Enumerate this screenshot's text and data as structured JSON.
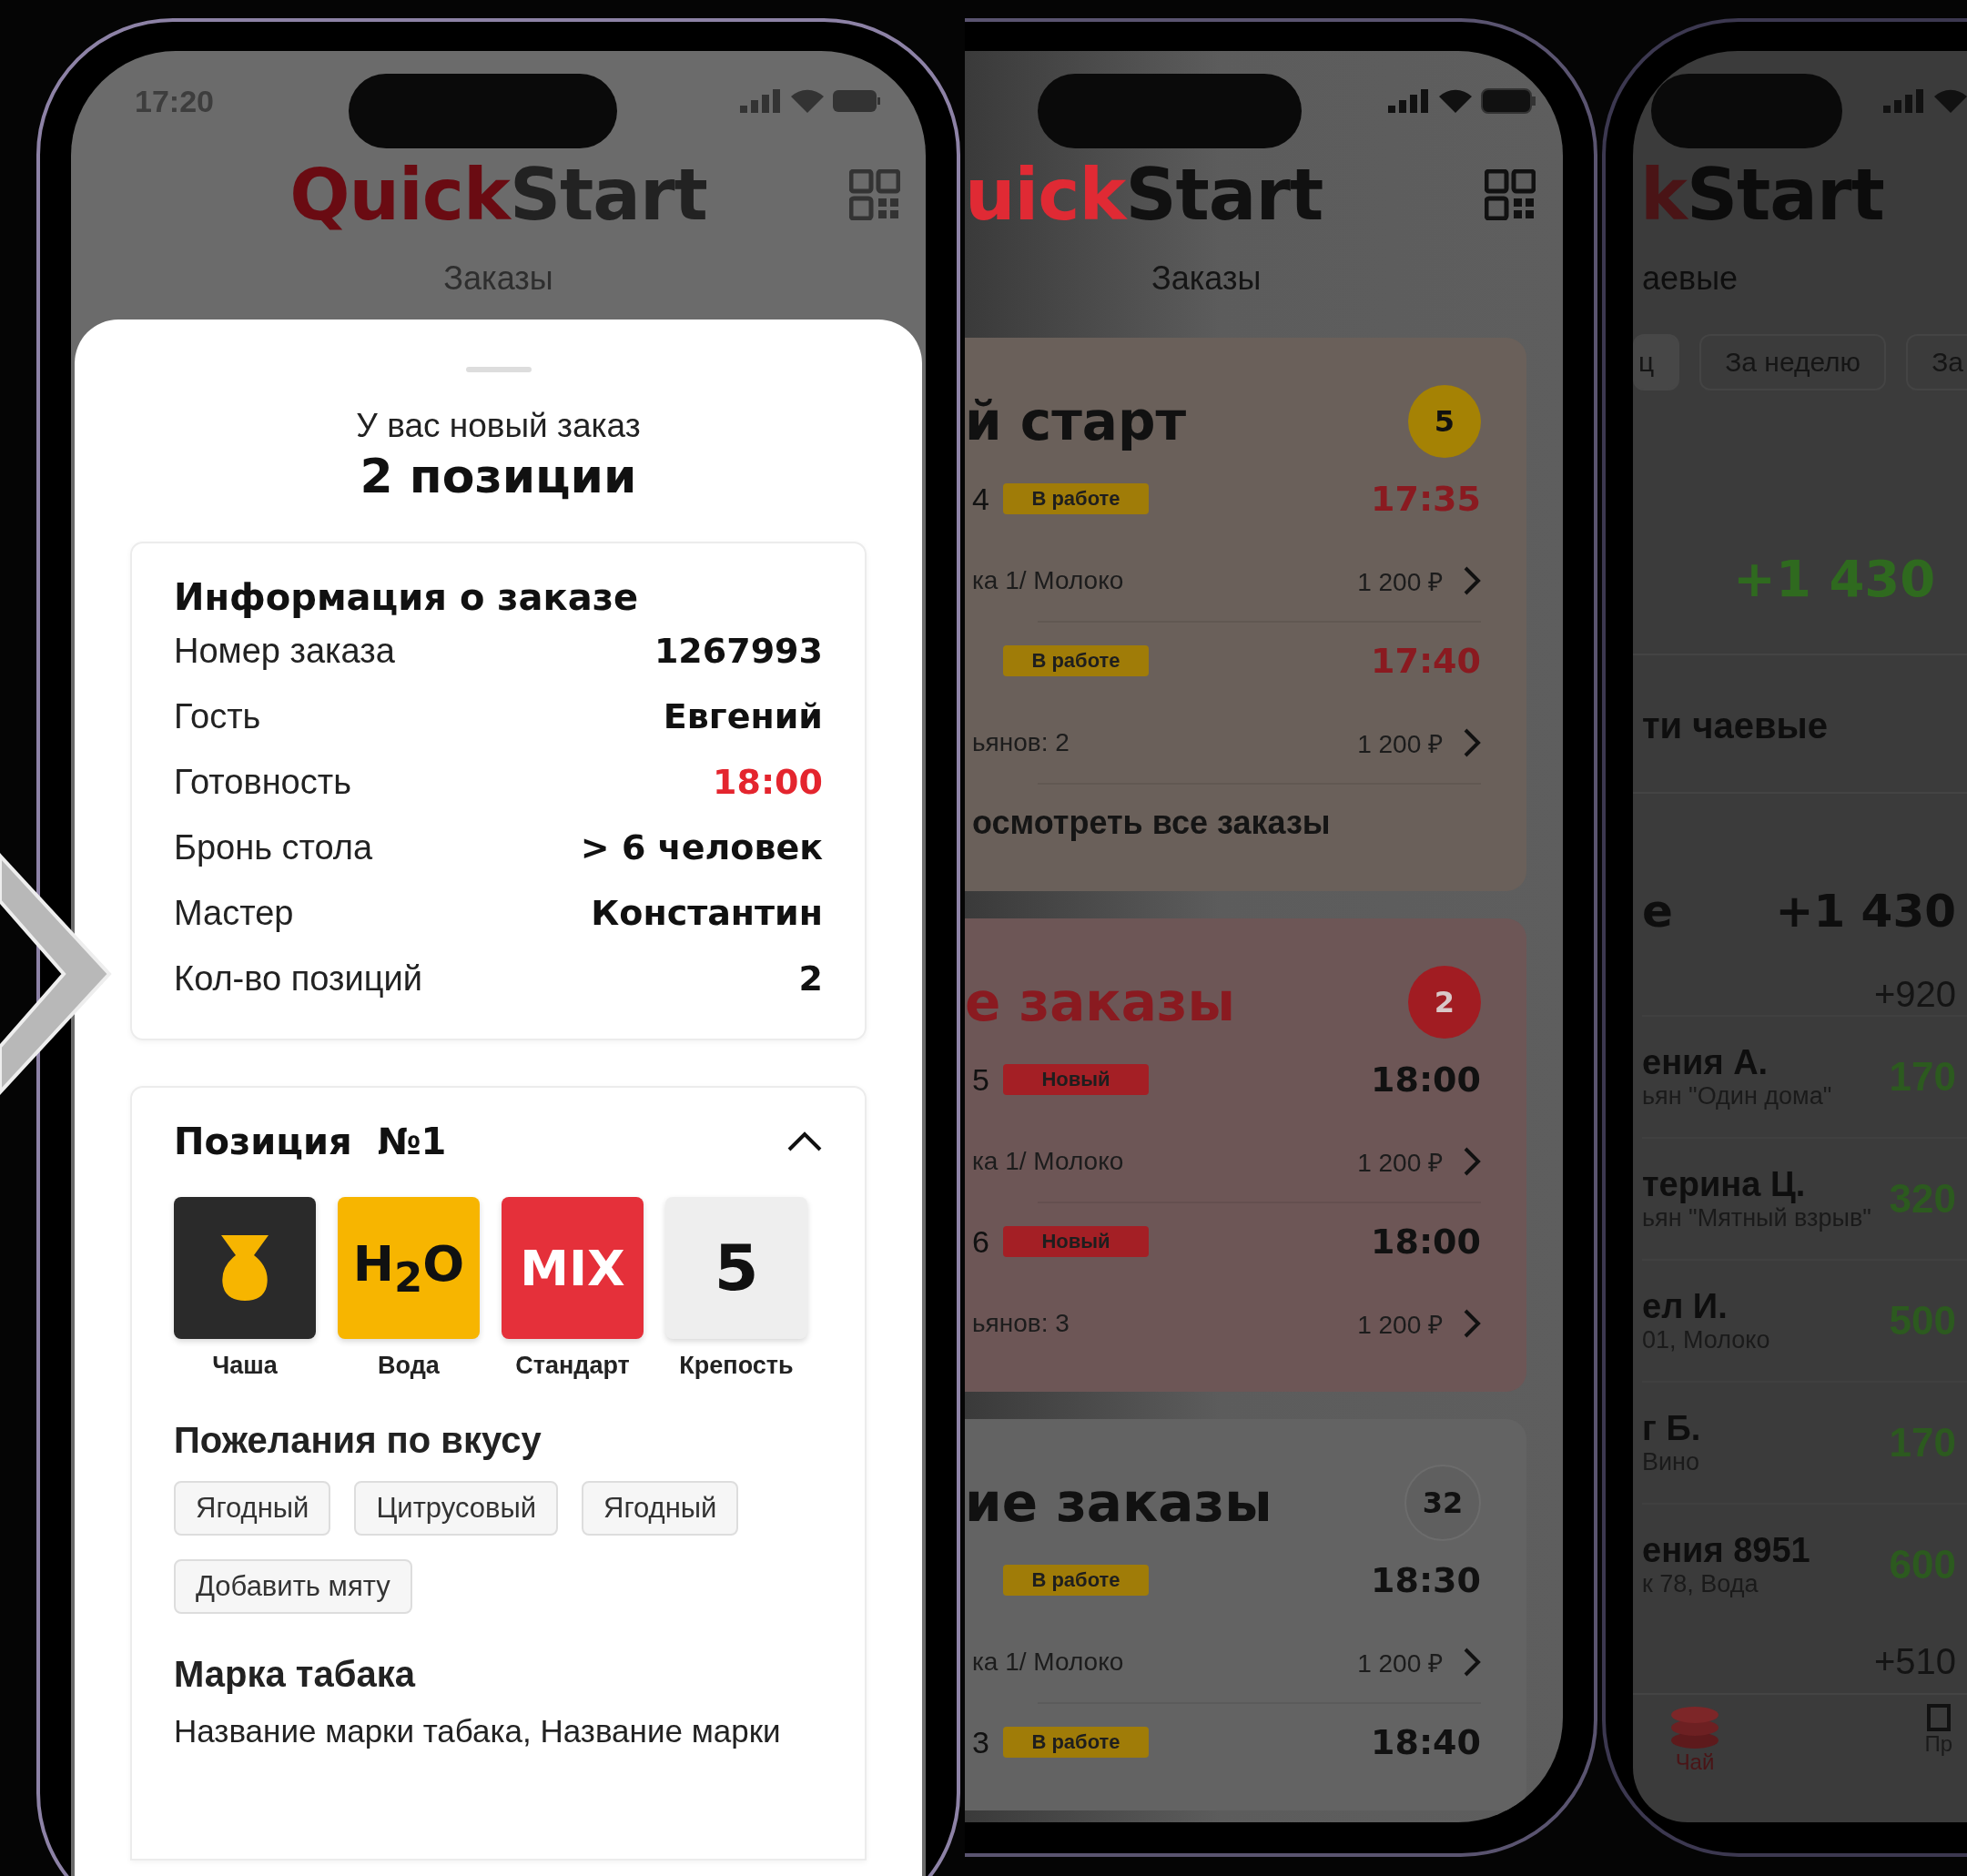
{
  "left_phone": {
    "status_time": "17:20",
    "logo": {
      "first": "Quick",
      "second": "Start"
    },
    "screen_title": "Заказы",
    "sheet": {
      "subtitle": "У вас новый заказ",
      "title": "2 позиции",
      "info": {
        "title": "Информация о заказе",
        "rows": [
          {
            "label": "Номер заказа",
            "value": "1267993",
            "accent": false
          },
          {
            "label": "Гость",
            "value": "Евгений",
            "accent": false
          },
          {
            "label": "Готовность",
            "value": "18:00",
            "accent": true
          },
          {
            "label": "Бронь стола",
            "value": "> 6 человек",
            "accent": false
          },
          {
            "label": "Мастер",
            "value": "Константин",
            "accent": false
          },
          {
            "label": "Кол-во позиций",
            "value": "2",
            "accent": false
          }
        ]
      },
      "position": {
        "title": "Позиция  №1",
        "expanded": true,
        "tiles": [
          {
            "kind": "bowl",
            "label": "Чаша"
          },
          {
            "kind": "water",
            "symbol": "H$_{2}$O",
            "label": "Вода"
          },
          {
            "kind": "mix",
            "symbol": "MIX",
            "label": "Стандарт"
          },
          {
            "kind": "strength",
            "symbol": "5",
            "label": "Крепость"
          }
        ],
        "wishes_title": "Пожелания по вкусу",
        "wishes": [
          "Ягодный",
          "Цитрусовый",
          "Ягодный",
          "Добавить мяту"
        ],
        "brand_title": "Марка табака",
        "brand_text": "Название марки табака, Название марки"
      }
    }
  },
  "middle_phone": {
    "logo": {
      "first": "uick",
      "second": "Start"
    },
    "screen_title": "Заказы",
    "cards": [
      {
        "kind": "start",
        "title": "й старт",
        "count": "5",
        "orders": [
          {
            "number": "4",
            "status": "В работе",
            "color": "#a07c08",
            "time": "17:35",
            "late": true,
            "detail": "ка 1/ Молоко",
            "price": "1 200 ₽"
          },
          {
            "status": "В работе",
            "color": "#a07c08",
            "time": "17:40",
            "late": true,
            "detail": "ьянов: 2",
            "price": "1 200 ₽"
          }
        ],
        "link": "осмотреть все заказы"
      },
      {
        "kind": "new",
        "title": "е заказы",
        "count": "2",
        "orders": [
          {
            "number": "5",
            "status": "Новый",
            "color": "#a41f25",
            "time": "18:00",
            "late": false,
            "detail": "ка 1/ Молоко",
            "price": "1 200 ₽"
          },
          {
            "number": "6",
            "status": "Новый",
            "color": "#a41f25",
            "time": "18:00",
            "late": false,
            "detail": "ьянов: 3",
            "price": "1 200 ₽"
          }
        ]
      },
      {
        "kind": "all",
        "title": "ие заказы",
        "count": "32",
        "orders": [
          {
            "status": "В работе",
            "color": "#a07c08",
            "time": "18:30",
            "late": false,
            "detail": "ка 1/ Молоко",
            "price": "1 200 ₽"
          },
          {
            "number": "3",
            "status": "В работе",
            "color": "#a07c08",
            "time": "18:40",
            "late": false
          }
        ]
      }
    ]
  },
  "right_phone": {
    "logo": {
      "first": "k",
      "second": "Start"
    },
    "screen_title": "аевые",
    "periods": [
      {
        "label": "ц",
        "selected": true
      },
      {
        "label": "За неделю",
        "selected": false
      },
      {
        "label": "За",
        "selected": false
      }
    ],
    "total": "+1 430",
    "link": "ти чаевые",
    "section_title": "е",
    "section_total": "+1 430",
    "subtotal": "+920",
    "tips": [
      {
        "name": "ения А.",
        "detail": "ьян \"Один дома\"",
        "amount": "170"
      },
      {
        "name": "терина Ц.",
        "detail": "ьян \"Мятный взрыв\"",
        "amount": "320"
      },
      {
        "name": "ел И.",
        "detail": "01, Молоко",
        "amount": "500"
      },
      {
        "name": "г Б.",
        "detail": "Вино",
        "amount": "170"
      },
      {
        "name": "ения 8951",
        "detail": "к 78, Вода",
        "amount": "600"
      }
    ],
    "next_total": "+510",
    "tabs": [
      {
        "kind": "tips",
        "label": "Чай",
        "selected": true
      },
      {
        "kind": "other",
        "label": "Пр",
        "selected": false
      }
    ]
  }
}
